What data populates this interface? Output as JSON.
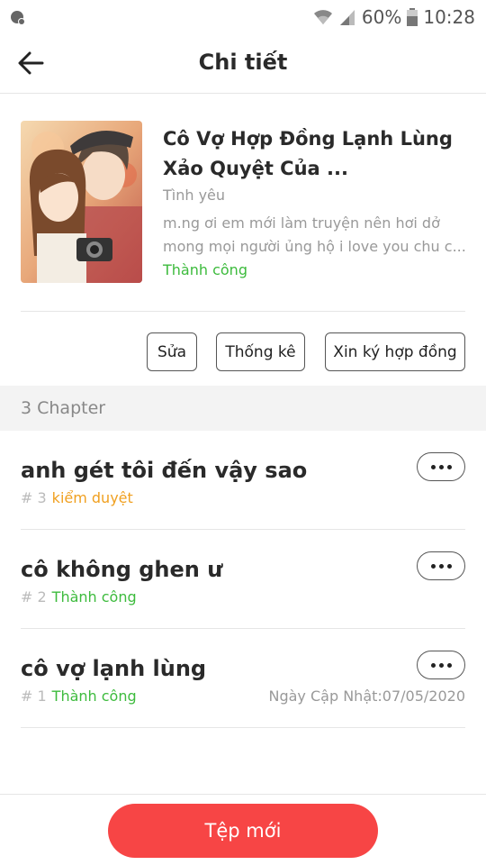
{
  "status_bar": {
    "battery_pct": "60%",
    "clock": "10:28"
  },
  "header": {
    "title": "Chi tiết"
  },
  "book": {
    "title": "Cô Vợ Hợp Đồng Lạnh Lùng Xảo Quyệt Của ...",
    "genre": "Tình yêu",
    "description": "m.ng ơi em mới làm truyện nên hơi dở mong mọi người ủng hộ i love you chu c...",
    "status": "Thành công"
  },
  "actions": {
    "edit_label": "Sửa",
    "stats_label": "Thống kê",
    "contract_label": "Xin ký hợp đồng"
  },
  "chapters_header": "3 Chapter",
  "chapters": [
    {
      "title": "anh gét tôi đến vậy sao",
      "number": "# 3",
      "status": "kiểm duyệt",
      "date": ""
    },
    {
      "title": "cô không ghen ư",
      "number": "# 2",
      "status": "Thành công",
      "date": ""
    },
    {
      "title": "cô vợ lạnh lùng",
      "number": "# 1",
      "status": "Thành công",
      "date": "Ngày Cập Nhật:07/05/2020"
    }
  ],
  "footer": {
    "new_file_label": "Tệp mới"
  },
  "colors": {
    "accent": "#f74545",
    "success": "#3dbb3d",
    "pending": "#f0a020"
  }
}
